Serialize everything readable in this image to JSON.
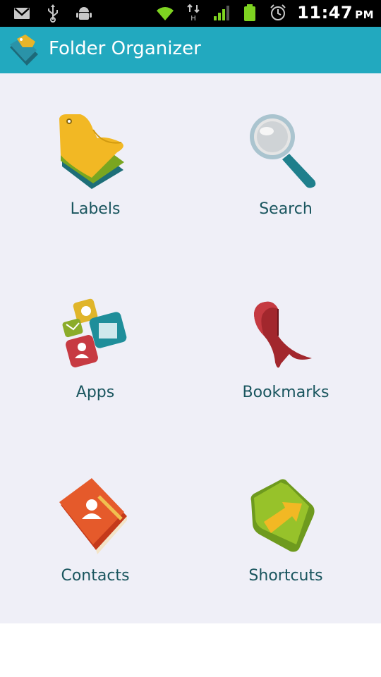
{
  "status_bar": {
    "time": "11:47",
    "ampm": "PM",
    "left_icons": [
      "gmail-icon",
      "usb-icon",
      "android-debug-icon"
    ],
    "right_icons": [
      "wifi-icon",
      "data-hspa-icon",
      "signal-icon",
      "battery-icon",
      "alarm-icon"
    ]
  },
  "app": {
    "title": "Folder Organizer",
    "header_color": "#22a9bf",
    "background_color": "#efeff7",
    "label_color": "#19555e"
  },
  "grid": {
    "items": [
      {
        "label": "Labels",
        "icon": "labels-icon"
      },
      {
        "label": "Search",
        "icon": "magnifier-icon"
      },
      {
        "label": "Apps",
        "icon": "apps-icon"
      },
      {
        "label": "Bookmarks",
        "icon": "bookmark-ribbon-icon"
      },
      {
        "label": "Contacts",
        "icon": "contacts-book-icon"
      },
      {
        "label": "Shortcuts",
        "icon": "shortcut-arrow-icon"
      }
    ]
  }
}
